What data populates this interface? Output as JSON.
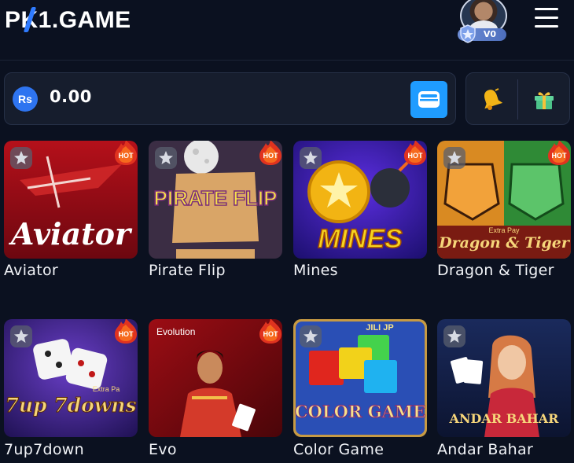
{
  "header": {
    "logo_text": "PK1.GAME",
    "vip_level": "V0"
  },
  "balance": {
    "currency_symbol": "Rs",
    "amount": "0.00"
  },
  "games": [
    {
      "name": "Aviator",
      "tile_art_text": "Aviator",
      "hot": true
    },
    {
      "name": "Pirate Flip",
      "tile_art_text": "PIRATE FLIP",
      "hot": true
    },
    {
      "name": "Mines",
      "tile_art_text": "MINES",
      "hot": true
    },
    {
      "name": "Dragon & Tiger",
      "tile_art_text": "Dragon & Tiger",
      "tile_art_subtext": "Extra Pay",
      "hot": true
    },
    {
      "name": "7up7down",
      "tile_art_text": "7up 7downs",
      "tile_art_subtext": "Extra Pa",
      "hot": true
    },
    {
      "name": "Evo",
      "tile_art_text": "Evolution",
      "hot": true
    },
    {
      "name": "Color Game",
      "tile_art_text": "COLOR GAME",
      "tile_art_subtext": "JILI JP",
      "hot": false
    },
    {
      "name": "Andar Bahar",
      "tile_art_text": "ANDAR BAHAR",
      "hot": false
    }
  ],
  "icons": {
    "menu": "hamburger-menu-icon",
    "wallet": "wallet-icon",
    "bell": "bell-icon",
    "gift": "gift-icon",
    "favorite": "star-icon",
    "hot": "hot-flame-badge"
  },
  "colors": {
    "background": "#0b1120",
    "card": "#161d2d",
    "accent_blue": "#1f9cff",
    "hot_red": "#e0331f"
  }
}
